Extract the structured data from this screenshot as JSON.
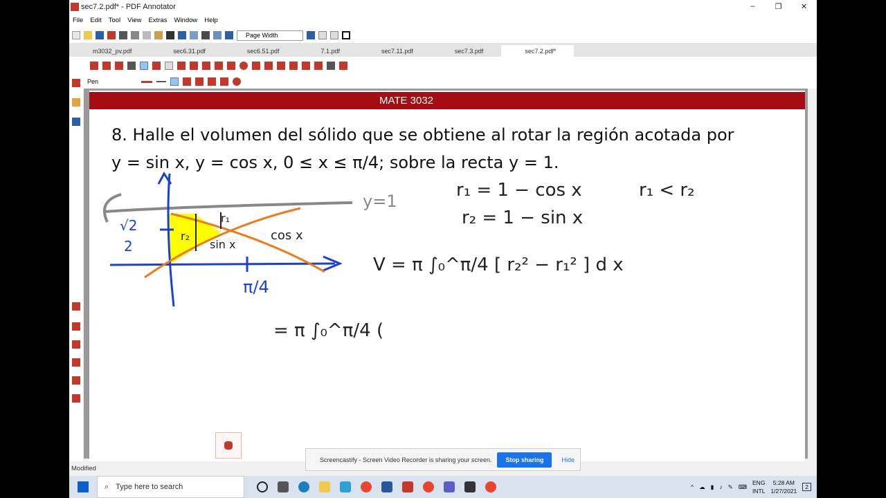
{
  "window": {
    "title": "sec7.2.pdf* - PDF Annotator",
    "controls": [
      "–",
      "❐",
      "✕"
    ]
  },
  "menu": [
    "File",
    "Edit",
    "Tool",
    "View",
    "Extras",
    "Window",
    "Help"
  ],
  "toolbar": {
    "zoom_mode": "Page Width"
  },
  "tabs": [
    "m3032_pv.pdf",
    "sec6.31.pdf",
    "sec6.51.pdf",
    "7.1.pdf",
    "sec7.11.pdf",
    "sec7.3.pdf",
    "sec7.2.pdf*"
  ],
  "active_tab": "sec7.2.pdf*",
  "tool_label": "Pen",
  "page": {
    "header": "MATE 3032",
    "problem_line1": "8. Halle el volumen del sólido que se obtiene al rotar la región acotada por",
    "problem_line2": "y = sin x, y = cos x, 0 ≤ x ≤ π/4; sobre la recta y = 1."
  },
  "status": "Modified",
  "share_toast": {
    "message": "Screencastify - Screen Video Recorder is sharing your screen.",
    "stop": "Stop sharing",
    "hide": "Hide"
  },
  "taskbar": {
    "search_placeholder": "Type here to search",
    "lang1": "ENG",
    "lang2": "INTL",
    "time": "5:28 AM",
    "date": "1/27/2021",
    "notifications": "2"
  },
  "colors": {
    "banner": "#a50d12",
    "ink_blue": "#1a3fd6",
    "ink_orange": "#f07a1a",
    "highlight": "#ffff00"
  }
}
